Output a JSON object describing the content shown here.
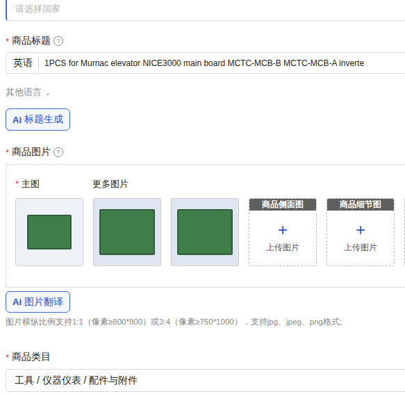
{
  "country_select": {
    "placeholder": "请选择国家"
  },
  "title_field": {
    "label": "商品标题",
    "required": "*",
    "help": "?",
    "language": "英语",
    "value": "1PCS for Murnac elevator NICE3000 main board MCTC-MCB-B MCTC-MCB-A inverte"
  },
  "other_languages": {
    "label": "其他语言",
    "icon": "⌄",
    "expanded": false
  },
  "title_ai_button": {
    "icon": "Ai",
    "label": "标题生成"
  },
  "images_field": {
    "label": "商品图片",
    "required": "*",
    "help": "?",
    "main_label": "主图",
    "main_required": "*",
    "more_label": "更多图片",
    "images": [
      {
        "kind": "photo",
        "main": true
      },
      {
        "kind": "photo",
        "main": false
      },
      {
        "kind": "photo",
        "main": false
      },
      {
        "kind": "upload",
        "main": false,
        "header": "商品侧面图",
        "icon": "+",
        "label": "上传图片"
      },
      {
        "kind": "upload",
        "main": false,
        "header": "商品细节图",
        "icon": "+",
        "label": "上传图片"
      }
    ]
  },
  "image_ai_button": {
    "icon": "Ai",
    "label": "图片翻译"
  },
  "image_hint": "图片横纵比例支持1:1（像素≥800*800）或3:4（像素≥750*1000），支持jpg、jpeg、png格式;",
  "category_field": {
    "label": "商品类目",
    "required": "*",
    "value": "工具 / 仪器仪表 / 配件与附件"
  }
}
